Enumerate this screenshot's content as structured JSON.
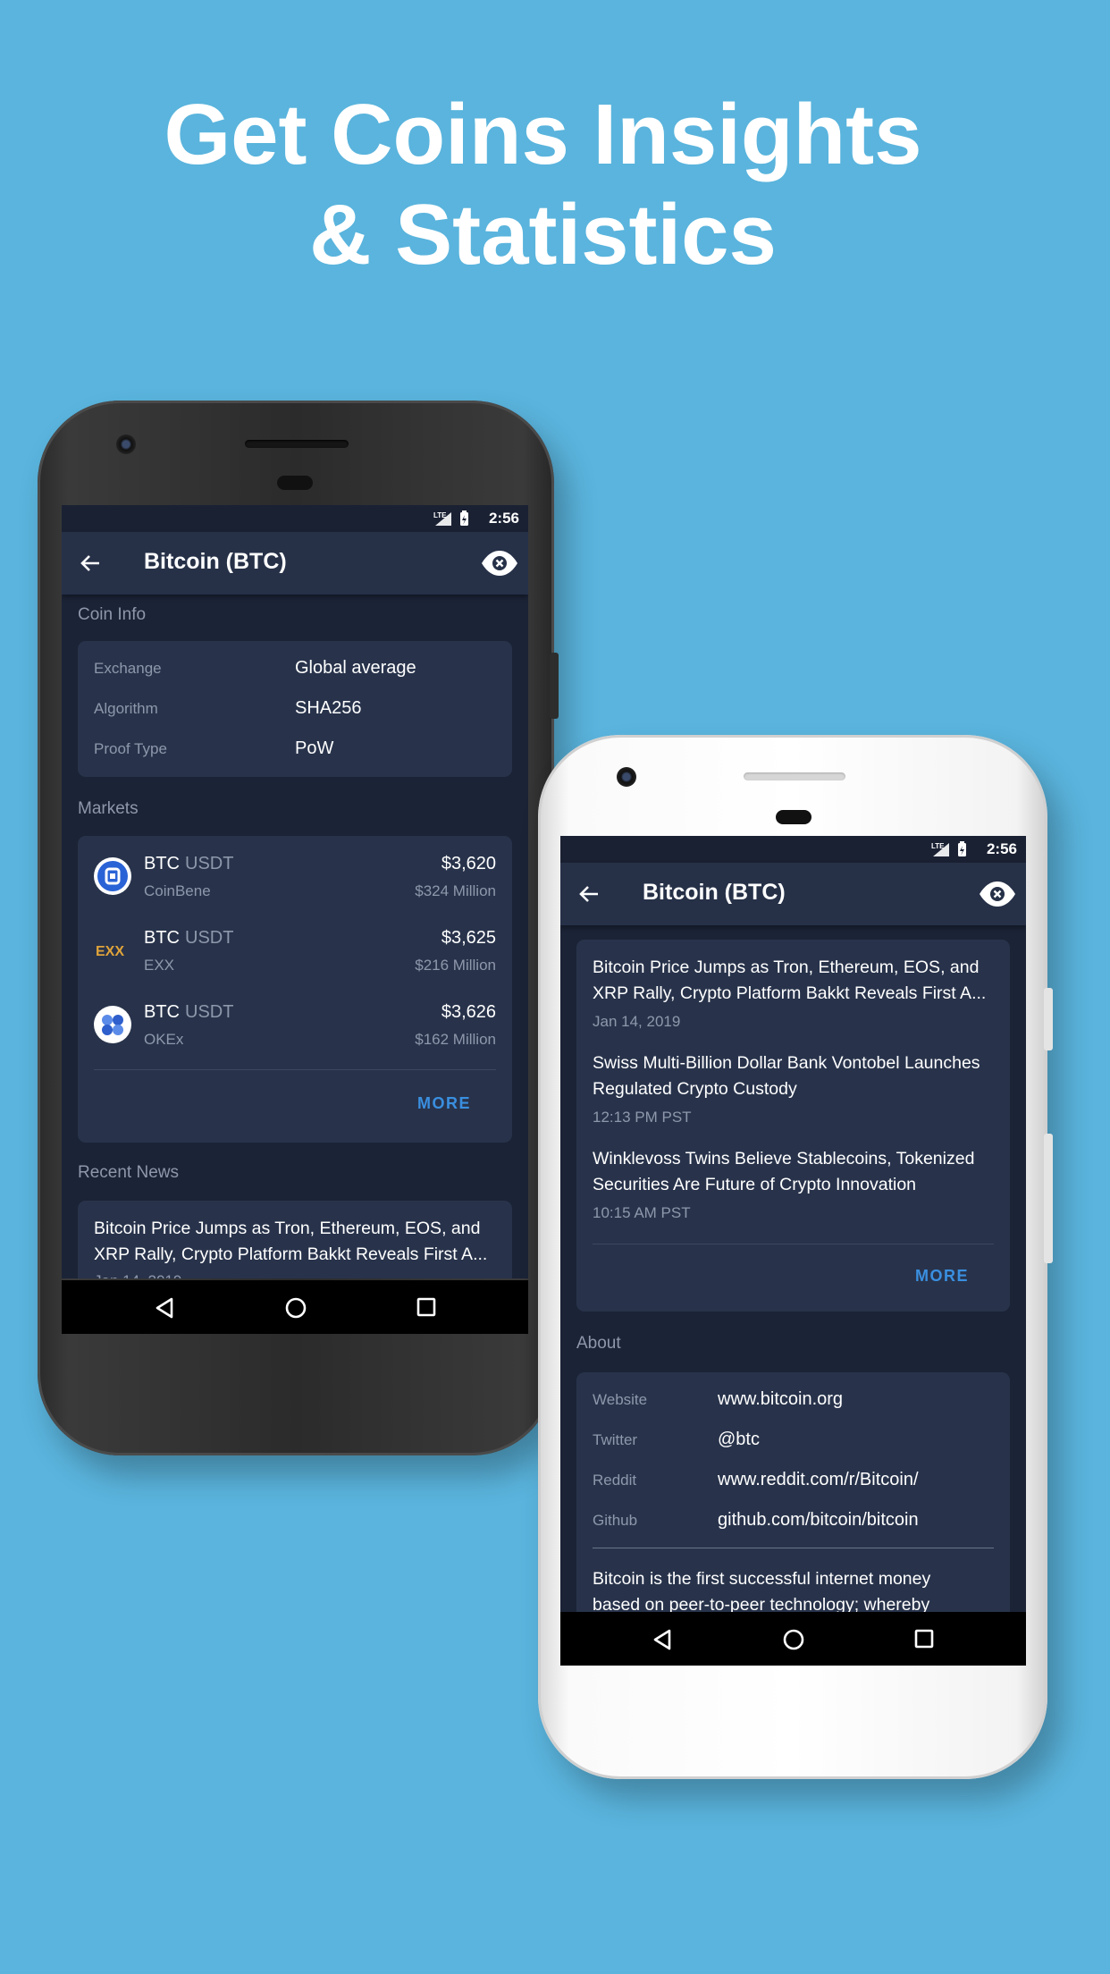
{
  "headline": {
    "line1": "Get Coins Insights",
    "line2": "& Statistics"
  },
  "status": {
    "time": "2:56",
    "network": "LTE"
  },
  "appbar": {
    "title": "Bitcoin (BTC)"
  },
  "coin_info": {
    "label": "Coin Info",
    "rows": [
      {
        "key": "Exchange",
        "value": "Global average"
      },
      {
        "key": "Algorithm",
        "value": "SHA256"
      },
      {
        "key": "Proof Type",
        "value": "PoW"
      }
    ]
  },
  "markets": {
    "label": "Markets",
    "items": [
      {
        "base": "BTC",
        "quote": "USDT",
        "exchange": "CoinBene",
        "price": "$3,620",
        "volume": "$324 Million",
        "logo": "coinbene-logo"
      },
      {
        "base": "BTC",
        "quote": "USDT",
        "exchange": "EXX",
        "price": "$3,625",
        "volume": "$216 Million",
        "logo": "exx-logo"
      },
      {
        "base": "BTC",
        "quote": "USDT",
        "exchange": "OKEx",
        "price": "$3,626",
        "volume": "$162 Million",
        "logo": "okex-logo"
      }
    ],
    "more": "MORE"
  },
  "recent_news": {
    "label": "Recent News",
    "items": [
      {
        "line1": "Bitcoin Price Jumps as Tron, Ethereum, EOS, and",
        "line2": "XRP Rally, Crypto Platform Bakkt Reveals First A...",
        "time": "Jan 14, 2019"
      },
      {
        "line1": "Swiss Multi-Billion Dollar Bank Vontobel Launches",
        "line2": "Regulated Crypto Custody",
        "time": "12:13 PM PST"
      },
      {
        "line1": "Winklevoss Twins Believe Stablecoins, Tokenized",
        "line2": "Securities Are Future of Crypto Innovation",
        "time": "10:15 AM PST"
      }
    ],
    "more": "MORE"
  },
  "about": {
    "label": "About",
    "rows": [
      {
        "key": "Website",
        "value": "www.bitcoin.org"
      },
      {
        "key": "Twitter",
        "value": "@btc"
      },
      {
        "key": "Reddit",
        "value": "www.reddit.com/r/Bitcoin/"
      },
      {
        "key": "Github",
        "value": "github.com/bitcoin/bitcoin"
      }
    ],
    "desc_line1": "Bitcoin is the first successful internet money",
    "desc_line2": "based on peer-to-peer technology; whereby"
  },
  "colors": {
    "background": "#5ab4dd",
    "screen": "#1b2336",
    "card": "#28334b",
    "appbar": "#263148",
    "accent": "#3a8fe0",
    "muted_text": "#8e97ab"
  }
}
